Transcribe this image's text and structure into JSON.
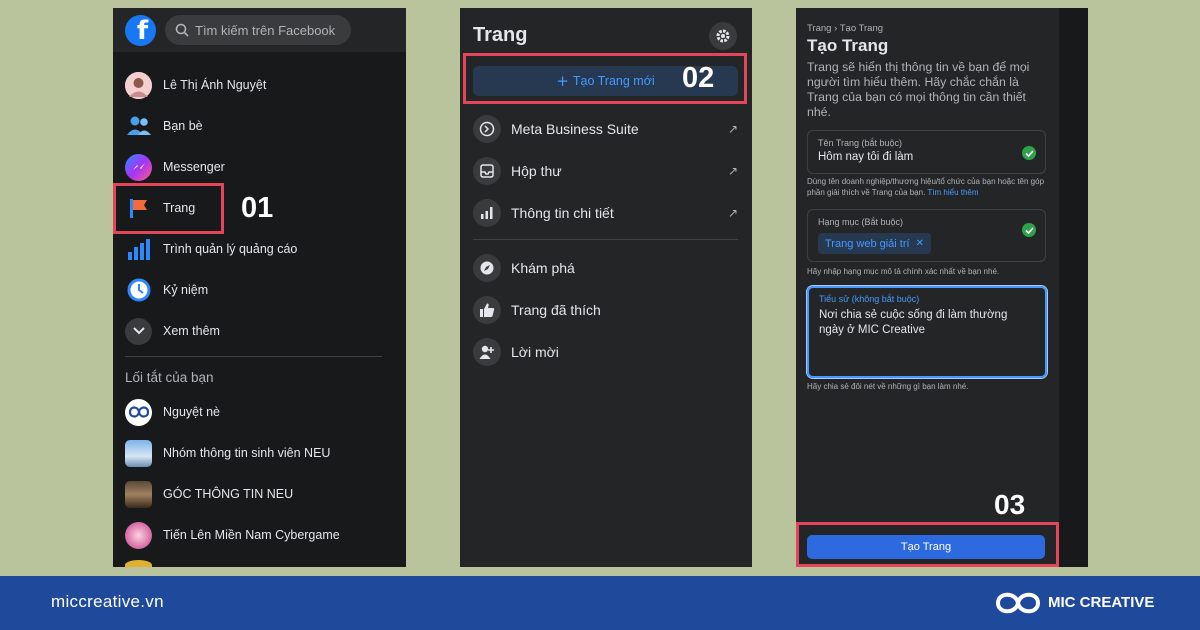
{
  "panel1": {
    "search_placeholder": "Tìm kiếm trên Facebook",
    "nav_items": [
      {
        "label": "Lê Thị Ánh Nguyệt",
        "icon": "user-avatar"
      },
      {
        "label": "Bạn bè",
        "icon": "friends-icon"
      },
      {
        "label": "Messenger",
        "icon": "messenger-icon"
      },
      {
        "label": "Trang",
        "icon": "flag-icon"
      },
      {
        "label": "Trình quản lý quảng cáo",
        "icon": "bar-chart-icon"
      },
      {
        "label": "Kỷ niệm",
        "icon": "clock-icon"
      },
      {
        "label": "Xem thêm",
        "icon": "chevron-down-icon"
      }
    ],
    "shortcuts_title": "Lối tắt của bạn",
    "shortcuts": [
      {
        "label": "Nguyệt nè",
        "icon": "mic-logo-avatar"
      },
      {
        "label": "Nhóm thông tin sinh viên NEU",
        "icon": "group-avatar"
      },
      {
        "label": "GÓC THÔNG TIN NEU",
        "icon": "page-avatar"
      },
      {
        "label": "Tiến Lên Miền Nam Cybergame",
        "icon": "game-avatar"
      }
    ],
    "step": "01"
  },
  "panel2": {
    "title": "Trang",
    "create_button": "Tạo Trang mới",
    "step": "02",
    "menu_group1": [
      {
        "label": "Meta Business Suite",
        "icon": "meta-business-icon"
      },
      {
        "label": "Hộp thư",
        "icon": "inbox-icon"
      },
      {
        "label": "Thông tin chi tiết",
        "icon": "insights-icon"
      }
    ],
    "menu_group2": [
      {
        "label": "Khám phá",
        "icon": "compass-icon"
      },
      {
        "label": "Trang đã thích",
        "icon": "thumbs-up-icon"
      },
      {
        "label": "Lời mời",
        "icon": "add-person-icon"
      }
    ]
  },
  "panel3": {
    "breadcrumb": "Trang › Tạo Trang",
    "title": "Tạo Trang",
    "description": "Trang sẽ hiển thị thông tin về bạn để mọi người tìm hiểu thêm. Hãy chắc chắn là Trang của bạn có mọi thông tin cần thiết nhé.",
    "page_name_label": "Tên Trang (bắt buộc)",
    "page_name_value": "Hôm nay tôi đi làm",
    "page_name_help": "Dùng tên doanh nghiệp/thương hiệu/tổ chức của bạn hoặc tên góp phần giải thích về Trang của bạn.",
    "page_name_help_link": "Tìm hiểu thêm",
    "category_label": "Hạng mục (Bắt buộc)",
    "category_chip": "Trang web giải trí",
    "category_help": "Hãy nhập hạng mục mô tả chính xác nhất về bạn nhé.",
    "bio_label": "Tiểu sử (không bắt buộc)",
    "bio_value": "Nơi chia sẻ cuộc sống đi làm thường ngày ở MIC Creative",
    "bio_help": "Hãy chia sẻ đôi nét về những gì bạn làm nhé.",
    "submit_button": "Tạo Trang",
    "step": "03"
  },
  "footer": {
    "website": "miccreative.vn",
    "brand": "MIC CREATIVE"
  },
  "colors": {
    "background": "#b9c49c",
    "highlight": "#e5455a",
    "facebook_blue": "#1877f2",
    "footer": "#1f4a9c"
  }
}
